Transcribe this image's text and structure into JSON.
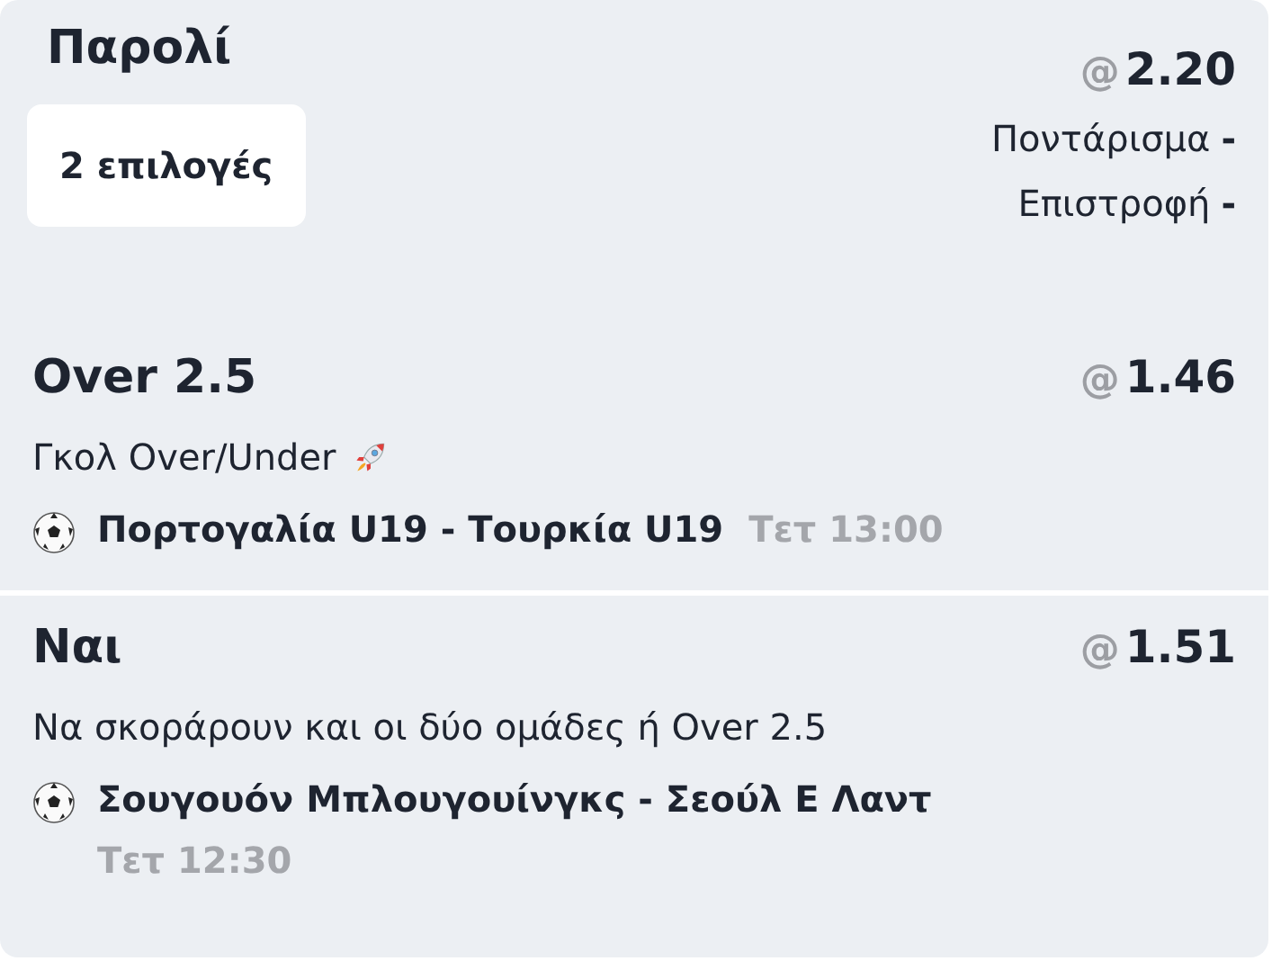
{
  "bet_type": {
    "title": "Παρολί",
    "at": "@",
    "odds": "2.20",
    "selections_count": "2 επιλογές",
    "stake_label": "Ποντάρισμα",
    "stake_value": "-",
    "return_label": "Επιστροφή",
    "return_value": "-"
  },
  "selections": [
    {
      "pick": "Over 2.5",
      "at": "@",
      "odds": "1.46",
      "market": "Γκολ Over/Under",
      "hot": true,
      "match": "Πορτογαλία U19 - Τουρκία U19",
      "time": "Τετ 13:00"
    },
    {
      "pick": "Ναι",
      "at": "@",
      "odds": "1.51",
      "market": "Να σκοράρουν και οι δύο ομάδες ή Over 2.5",
      "hot": false,
      "match": "Σουγουόν Μπλουγουίνγκς - Σεούλ Ε Λαντ",
      "time": "Τετ 12:30"
    }
  ]
}
